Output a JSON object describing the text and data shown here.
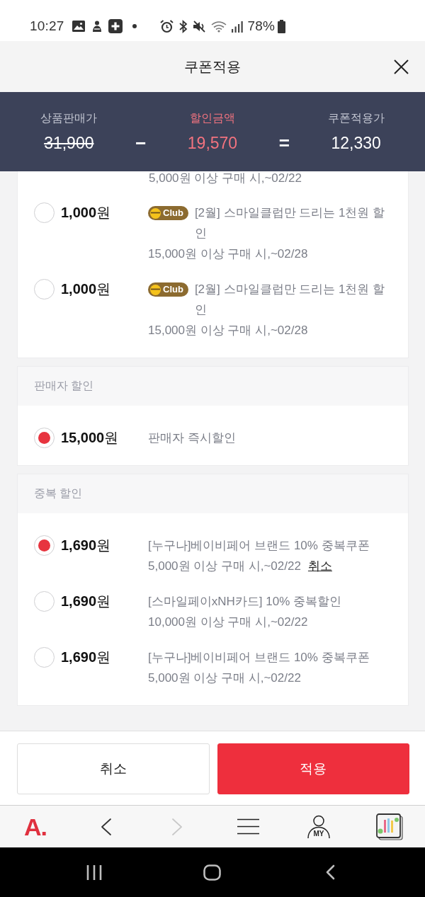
{
  "status_bar": {
    "time": "10:27",
    "battery": "78%"
  },
  "header": {
    "title": "쿠폰적용"
  },
  "summary": {
    "items": [
      {
        "kind": "original",
        "label": "상품판매가",
        "value": "31,900"
      },
      {
        "kind": "discount",
        "label": "할인금액",
        "value": "19,570"
      },
      {
        "kind": "final",
        "label": "쿠폰적용가",
        "value": "12,330"
      }
    ],
    "operators": [
      "−",
      "="
    ]
  },
  "sections": [
    {
      "clipped_condition": "5,000원 이상 구매 시,~02/22",
      "coupons": [
        {
          "amount": "**1,000**원",
          "selected": false,
          "badge": "Club",
          "description": "[2월] 스마일클럽만 드리는 1천원 할인",
          "condition": "15,000원 이상 구매 시,~02/28"
        },
        {
          "amount": "**1,000**원",
          "selected": false,
          "badge": "Club",
          "description": "[2월] 스마일클럽만 드리는 1천원 할인",
          "condition": "15,000원 이상 구매 시,~02/28"
        }
      ]
    },
    {
      "title": "판매자 할인",
      "coupons": [
        {
          "amount": "**15,000**원",
          "selected": true,
          "description": "판매자 즉시할인"
        }
      ]
    },
    {
      "title": "중복 할인",
      "coupons": [
        {
          "amount": "**1,690**원",
          "selected": true,
          "description": "[누구나]베이비페어 브랜드 10% 중복쿠폰",
          "condition": "5,000원 이상 구매 시,~02/22",
          "cancel_link": "취소"
        },
        {
          "amount": "**1,690**원",
          "selected": false,
          "description": "[스마일페이xNH카드] 10% 중복할인",
          "condition": "10,000원 이상 구매 시,~02/22"
        },
        {
          "amount": "**1,690**원",
          "selected": false,
          "description": "[누구나]베이비페어 브랜드 10% 중복쿠폰",
          "condition": "5,000원 이상 구매 시,~02/22"
        }
      ]
    }
  ],
  "footer": {
    "buttons": [
      {
        "kind": "secondary",
        "label": "취소"
      },
      {
        "kind": "primary",
        "label": "적용"
      }
    ]
  },
  "toolbar": {
    "logo": "A.",
    "back": {
      "disabled": false
    },
    "forward": {
      "disabled": true
    },
    "profile_label": "MY"
  }
}
